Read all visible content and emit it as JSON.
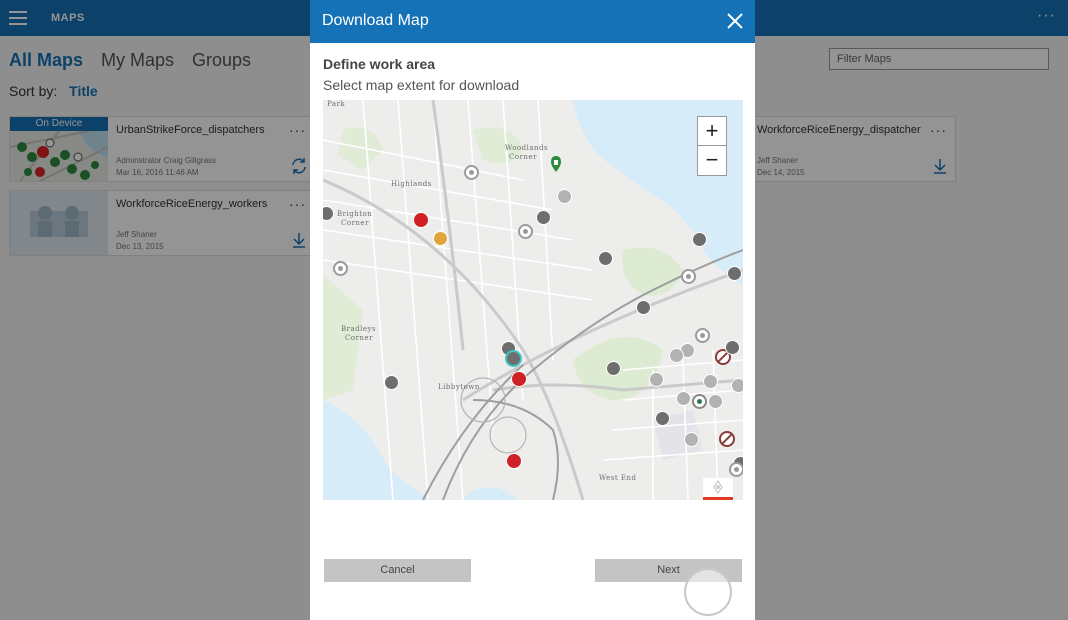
{
  "app": {
    "title": "MAPS",
    "tabs": [
      {
        "label": "All Maps",
        "active": true
      },
      {
        "label": "My Maps",
        "active": false
      },
      {
        "label": "Groups",
        "active": false
      }
    ],
    "sort_label": "Sort by:",
    "sort_value": "Title",
    "filter_placeholder": "Filter Maps",
    "more_glyph": "···"
  },
  "cards": [
    {
      "name": "UrbanStrikeForce_dispatchers",
      "owner": "Adminstrator Craig Gillgrass",
      "date": "Mar 16, 2016 11:46 AM",
      "badge": "On Device",
      "status_icon": "sync-icon"
    },
    {
      "name": "WorkforceRiceEnergy_workers",
      "owner": "Jeff Shaner",
      "date": "Dec 13, 2015",
      "status_icon": "download-icon"
    },
    {
      "name": "WorkforceRiceEnergy_dispatcher",
      "owner": "Jeff Shaner",
      "date": "Dec 14, 2015",
      "status_icon": "download-icon"
    }
  ],
  "dialog": {
    "title": "Download Map",
    "heading": "Define work area",
    "subheading": "Select map extent for download",
    "zoom_in": "+",
    "zoom_out": "−",
    "cancel_label": "Cancel",
    "next_label": "Next"
  },
  "map_labels": [
    "Park",
    "Woodlands",
    "Corner",
    "Highlands",
    "Brighton",
    "Corner",
    "Bradleys",
    "Corner",
    "Libbytown",
    "West End"
  ],
  "colors": {
    "accent": "#1572b6",
    "water": "#d6ecf8",
    "park": "#dcebd2",
    "marker_red": "#cf2026",
    "marker_orange": "#e0a43a",
    "marker_dark": "#6e6e6e",
    "marker_light": "#b2b2b2"
  }
}
